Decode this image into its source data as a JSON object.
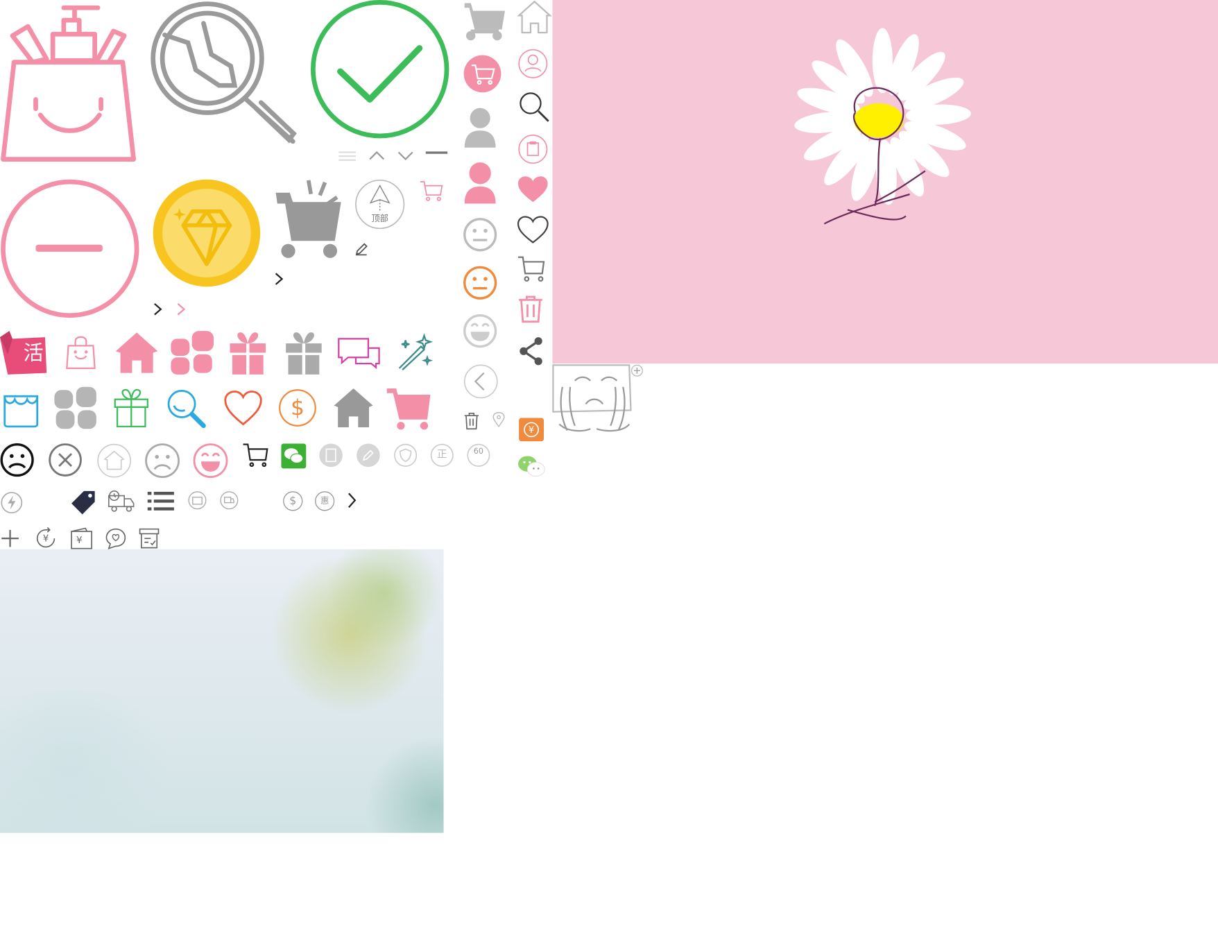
{
  "sprite_sheet": {
    "colors": {
      "pink": "#f48fa8",
      "gray": "#9a9a9a",
      "green": "#3cbd5a",
      "gold": "#f8c520",
      "orange": "#f08a3c",
      "blue": "#2aa9e0",
      "panel_pink": "#f7c7d7",
      "flower_yellow": "#fff000",
      "stem_purple": "#6b2c5c"
    },
    "labels": {
      "huo_badge": "活",
      "back_to_top": "顶部",
      "dollar_sign": "$",
      "yuan_sign": "¥",
      "zheng_badge": "正",
      "sixty_badge": "60",
      "hui_badge": "惠"
    },
    "icons": [
      "cosmetics-bag-icon",
      "magnifier-tool-icon",
      "check-circle-icon",
      "minus-circle-icon",
      "diamond-coin-icon",
      "cart-icon",
      "back-to-top-icon",
      "home-icon",
      "category-icon",
      "gift-icon",
      "chat-icon",
      "magic-wand-icon",
      "shop-icon",
      "search-icon",
      "heart-icon",
      "dollar-icon",
      "smile-icon",
      "sad-icon",
      "close-circle-icon",
      "wechat-icon",
      "tag-icon",
      "delivery-truck-icon",
      "list-icon",
      "user-icon",
      "trash-icon",
      "share-icon",
      "location-pin-icon",
      "crying-face-icon",
      "flower-illustration"
    ]
  }
}
